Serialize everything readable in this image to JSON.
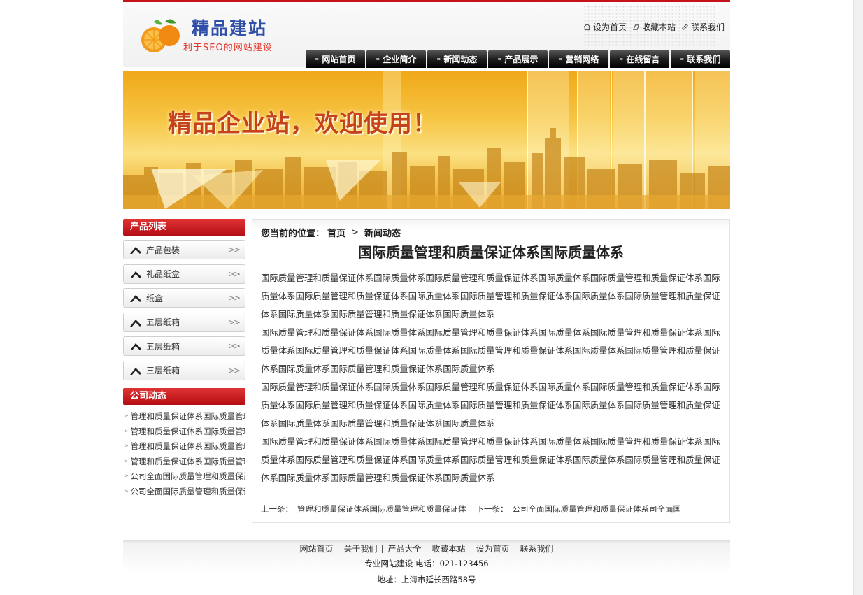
{
  "header": {
    "logo_title": "精品建站",
    "logo_subtitle": "利于SEO的网站建设",
    "top_links": [
      {
        "label": "设为首页",
        "icon": "home-icon"
      },
      {
        "label": "收藏本站",
        "icon": "bookmark-icon"
      },
      {
        "label": "联系我们",
        "icon": "contact-icon"
      }
    ],
    "nav": [
      "网站首页",
      "企业简介",
      "新闻动态",
      "产品展示",
      "营销网络",
      "在线留言",
      "联系我们"
    ]
  },
  "banner": {
    "headline": "精品企业站，欢迎使用！"
  },
  "sidebar": {
    "products_title": "产品列表",
    "products": [
      "产品包装",
      "礼品纸盒",
      "纸盒",
      "五层纸箱",
      "五层纸箱",
      "三层纸箱"
    ],
    "news_title": "公司动态",
    "news": [
      "管理和质量保证体系国际质量管理",
      "管理和质量保证体系国际质量管理",
      "管理和质量保证体系国际质量管理",
      "管理和质量保证体系国际质量管理",
      "公司全面国际质量管理和质量保证",
      "公司全面国际质量管理和质量保证"
    ]
  },
  "main": {
    "breadcrumb": {
      "prefix": "您当前的位置：",
      "home": "首页",
      "current": "新闻动态"
    },
    "title": "国际质量管理和质量保证体系国际质量体系",
    "paragraphs": [
      "国际质量管理和质量保证体系国际质量体系国际质量管理和质量保证体系国际质量体系国际质量管理和质量保证体系国际质量体系国际质量管理和质量保证体系国际质量体系国际质量管理和质量保证体系国际质量体系国际质量管理和质量保证体系国际质量体系国际质量管理和质量保证体系国际质量体系",
      "国际质量管理和质量保证体系国际质量体系国际质量管理和质量保证体系国际质量体系国际质量管理和质量保证体系国际质量体系国际质量管理和质量保证体系国际质量体系国际质量管理和质量保证体系国际质量体系国际质量管理和质量保证体系国际质量体系国际质量管理和质量保证体系国际质量体系",
      "国际质量管理和质量保证体系国际质量体系国际质量管理和质量保证体系国际质量体系国际质量管理和质量保证体系国际质量体系国际质量管理和质量保证体系国际质量体系国际质量管理和质量保证体系国际质量体系国际质量管理和质量保证体系国际质量体系国际质量管理和质量保证体系国际质量体系",
      "国际质量管理和质量保证体系国际质量体系国际质量管理和质量保证体系国际质量体系国际质量管理和质量保证体系国际质量体系国际质量管理和质量保证体系国际质量体系国际质量管理和质量保证体系国际质量体系国际质量管理和质量保证体系国际质量体系国际质量管理和质量保证体系国际质量体系"
    ],
    "prev_label": "上一条：",
    "prev_title": "管理和质量保证体系国际质量管理和质量保证体",
    "next_label": "下一条：",
    "next_title": "公司全面国际质量管理和质量保证体系司全面国"
  },
  "footer": {
    "links": [
      "网站首页",
      "关于我们",
      "产品大全",
      "收藏本站",
      "设为首页",
      "联系我们"
    ],
    "line1": "专业网站建设 电话：021-123456",
    "line2": "地址：上海市延长西路58号"
  },
  "colors": {
    "accent_red": "#c4141a",
    "nav_black": "#1c1c1c",
    "logo_blue": "#2f4fa8",
    "banner_gold": "#f6c544"
  }
}
